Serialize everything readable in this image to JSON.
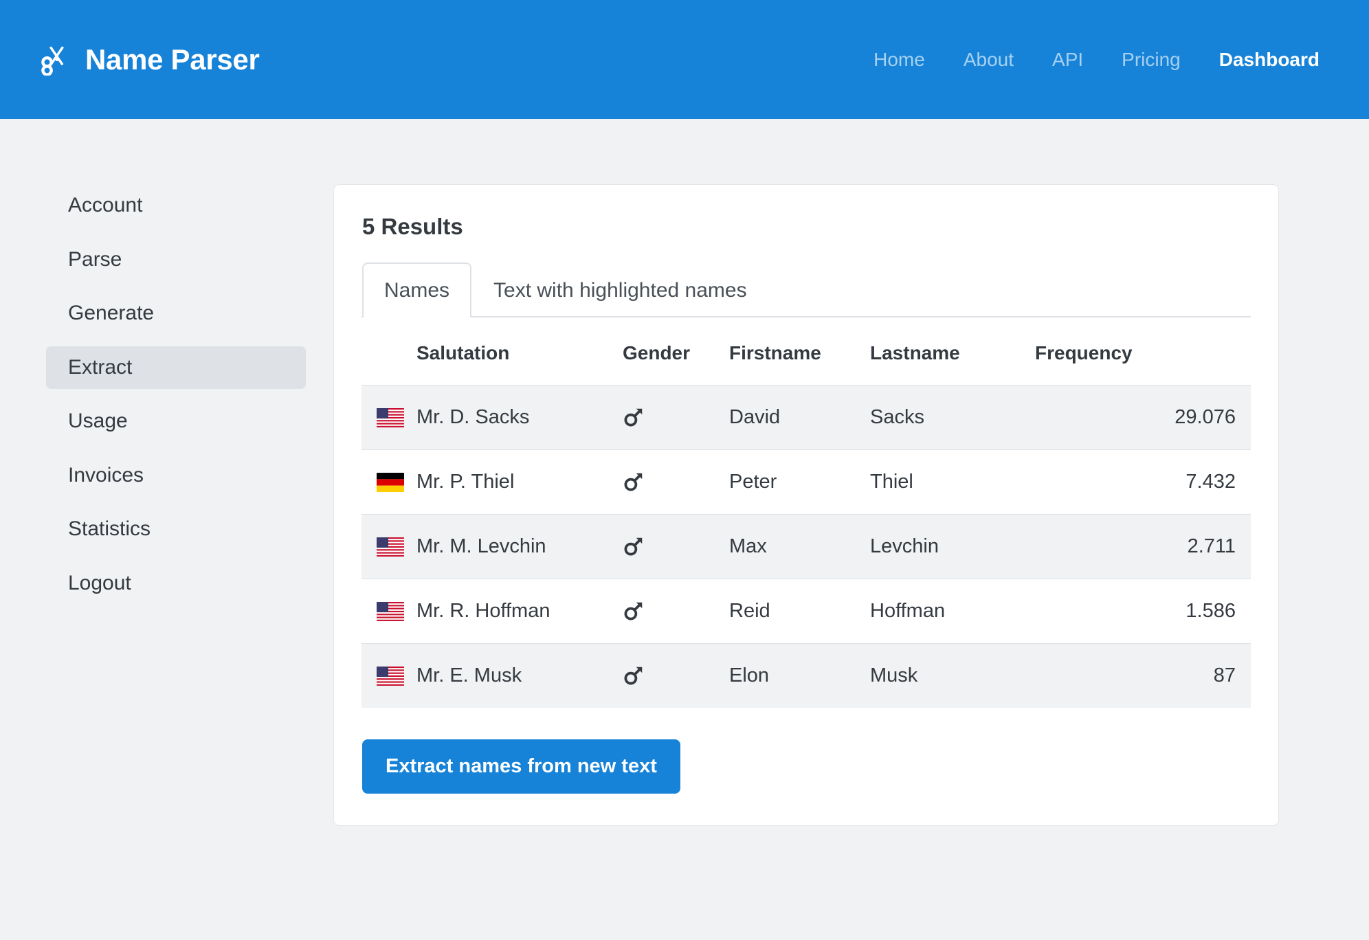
{
  "header": {
    "brand_name": "Name Parser",
    "brand_icon": "scissors-icon",
    "brand_color": "#1683d8",
    "nav": [
      {
        "label": "Home",
        "active": false
      },
      {
        "label": "About",
        "active": false
      },
      {
        "label": "API",
        "active": false
      },
      {
        "label": "Pricing",
        "active": false
      },
      {
        "label": "Dashboard",
        "active": true
      }
    ]
  },
  "sidebar": {
    "items": [
      {
        "label": "Account",
        "active": false
      },
      {
        "label": "Parse",
        "active": false
      },
      {
        "label": "Generate",
        "active": false
      },
      {
        "label": "Extract",
        "active": true
      },
      {
        "label": "Usage",
        "active": false
      },
      {
        "label": "Invoices",
        "active": false
      },
      {
        "label": "Statistics",
        "active": false
      },
      {
        "label": "Logout",
        "active": false
      }
    ],
    "active_background": "#dee2e6"
  },
  "main": {
    "title": "5 Results",
    "tabs": [
      {
        "label": "Names",
        "active": true
      },
      {
        "label": "Text with highlighted names",
        "active": false
      }
    ],
    "table": {
      "columns": [
        "",
        "Salutation",
        "Gender",
        "Firstname",
        "Lastname",
        "Frequency"
      ],
      "rows": [
        {
          "flag": "us-flag-icon",
          "salutation": "Mr. D. Sacks",
          "gender": "male",
          "gender_icon": "mars-icon",
          "firstname": "David",
          "lastname": "Sacks",
          "frequency": "29.076"
        },
        {
          "flag": "de-flag-icon",
          "salutation": "Mr. P. Thiel",
          "gender": "male",
          "gender_icon": "mars-icon",
          "firstname": "Peter",
          "lastname": "Thiel",
          "frequency": "7.432"
        },
        {
          "flag": "us-flag-icon",
          "salutation": "Mr. M. Levchin",
          "gender": "male",
          "gender_icon": "mars-icon",
          "firstname": "Max",
          "lastname": "Levchin",
          "frequency": "2.711"
        },
        {
          "flag": "us-flag-icon",
          "salutation": "Mr. R. Hoffman",
          "gender": "male",
          "gender_icon": "mars-icon",
          "firstname": "Reid",
          "lastname": "Hoffman",
          "frequency": "1.586"
        },
        {
          "flag": "us-flag-icon",
          "salutation": "Mr. E. Musk",
          "gender": "male",
          "gender_icon": "mars-icon",
          "firstname": "Elon",
          "lastname": "Musk",
          "frequency": "87"
        }
      ]
    },
    "primary_button": {
      "label": "Extract names from new text",
      "color": "#1683d8"
    }
  }
}
